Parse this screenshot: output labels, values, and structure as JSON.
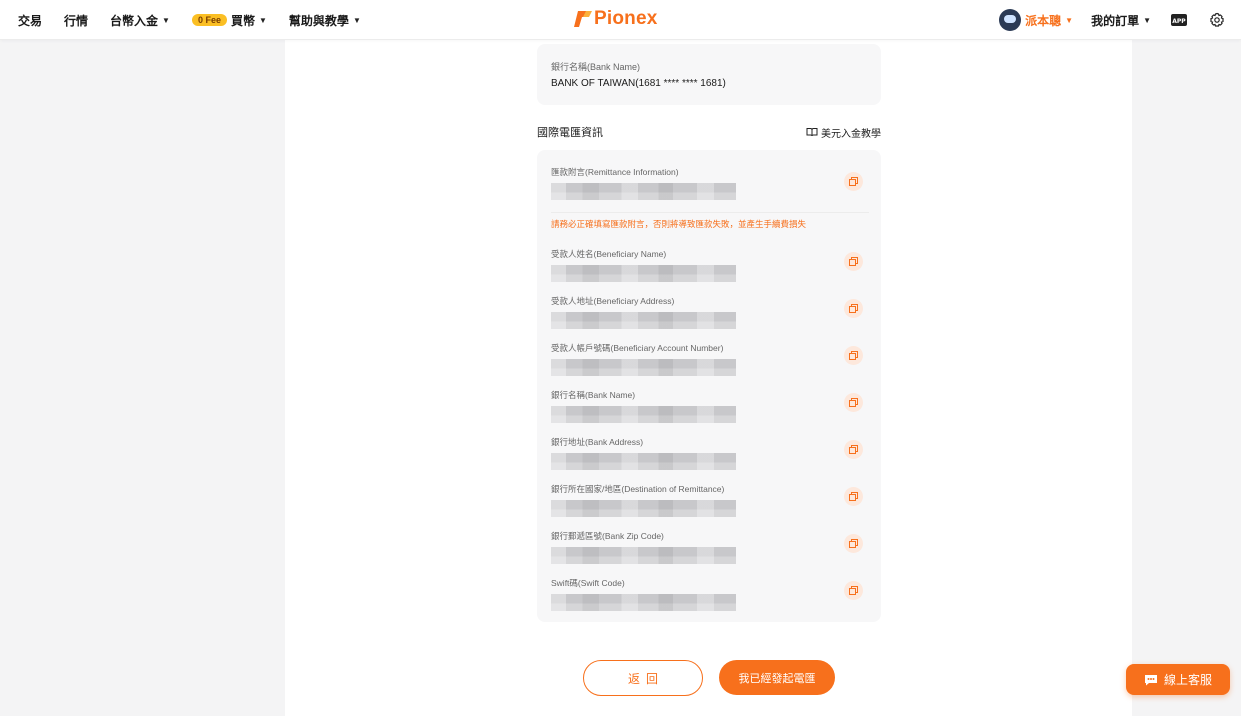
{
  "header": {
    "nav": {
      "trade": "交易",
      "market": "行情",
      "deposit": "台幣入金",
      "fee_badge": "0 Fee",
      "buy": "買幣",
      "help": "幫助與教學"
    },
    "brand": "Pionex",
    "user_name": "派本聰",
    "orders": "我的訂單",
    "icons": {
      "app": "app-icon",
      "settings": "gear-icon"
    }
  },
  "bank": {
    "label": "銀行名稱(Bank Name)",
    "value": "BANK OF TAIWAN(1681 **** **** 1681)"
  },
  "wire": {
    "title": "國際電匯資訊",
    "tutorial": "美元入金教學",
    "remittance_label": "匯款附言(Remittance Information)",
    "warning": "請務必正確填寫匯款附言，否則將導致匯款失敗，並產生手續費損失",
    "fields": [
      {
        "label": "受款人姓名(Beneficiary Name)"
      },
      {
        "label": "受款人地址(Beneficiary Address)"
      },
      {
        "label": "受款人帳戶號碼(Beneficiary Account Number)"
      },
      {
        "label": "銀行名稱(Bank Name)"
      },
      {
        "label": "銀行地址(Bank Address)"
      },
      {
        "label": "銀行所在國家/地區(Destination of Remittance)"
      },
      {
        "label": "銀行郵遞區號(Bank Zip Code)"
      },
      {
        "label": "Swift碼(Swift Code)"
      }
    ]
  },
  "actions": {
    "back": "返回",
    "sent": "我已經發起電匯"
  },
  "support": "線上客服",
  "colors": {
    "accent": "#f7701c",
    "badge": "#fbbf24",
    "card": "#f7f7f8"
  }
}
